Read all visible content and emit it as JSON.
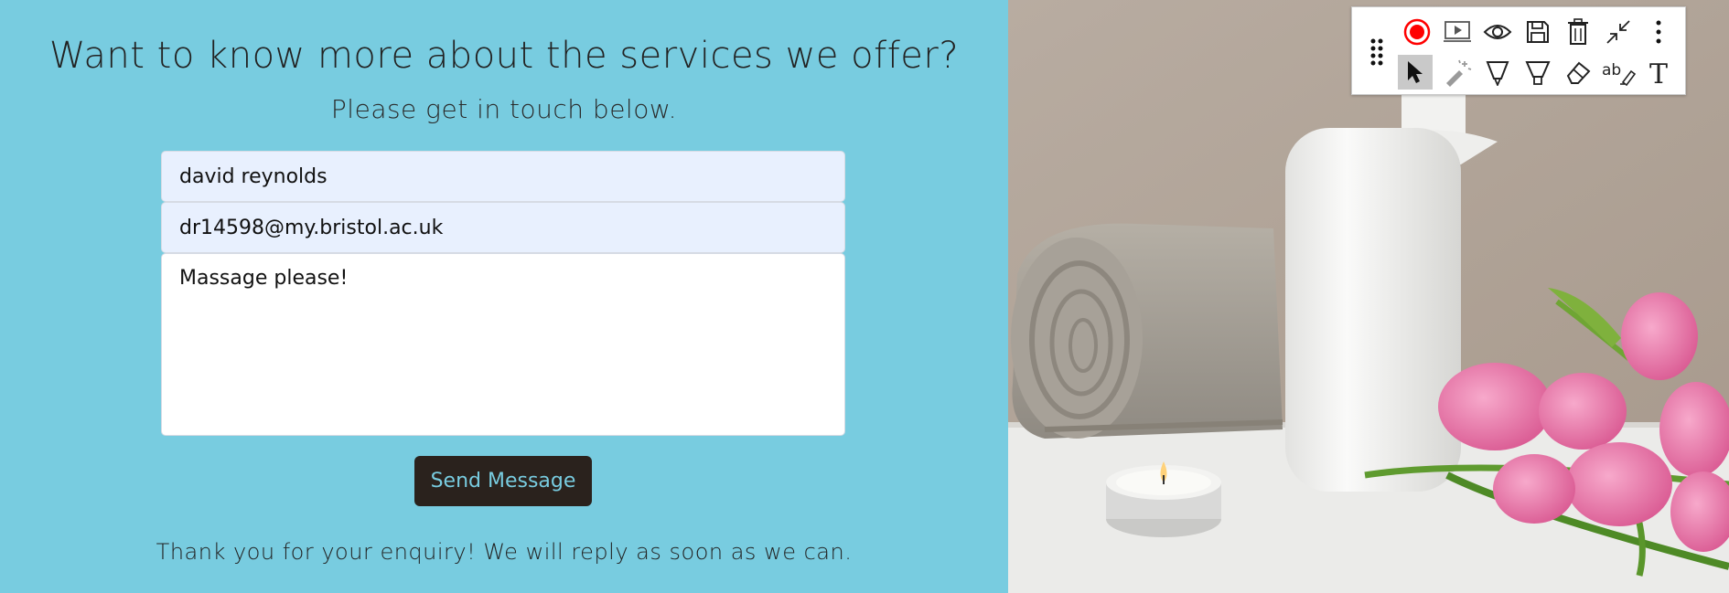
{
  "form": {
    "heading": "Want to know more about the services we offer?",
    "subheading": "Please get in touch below.",
    "name_value": "david reynolds",
    "email_value": "dr14598@my.bristol.ac.uk",
    "message_value": "Massage please!",
    "send_label": "Send Message",
    "confirmation": "Thank you for your enquiry! We will reply as soon as we can."
  },
  "colors": {
    "page_background": "#78cce0",
    "button_background": "#2a221d",
    "button_text": "#78cce0",
    "autofill_background": "#e8f0fe",
    "record_red": "#ff0000"
  },
  "toolbar": {
    "row1_icons": [
      "record-icon",
      "play-screen-icon",
      "eye-icon",
      "save-icon",
      "trash-icon",
      "collapse-icon",
      "more-vertical-icon"
    ],
    "row2_icons": [
      "cursor-icon",
      "laser-pointer-icon",
      "pen-icon",
      "highlighter-icon",
      "eraser-icon",
      "text-select-icon",
      "text-tool-icon"
    ],
    "active_tool": "cursor-icon",
    "text_select_glyph": "ab",
    "text_tool_glyph": "T"
  },
  "photo": {
    "subjects": [
      "towel",
      "bottle",
      "candle",
      "pink-tulips"
    ]
  }
}
